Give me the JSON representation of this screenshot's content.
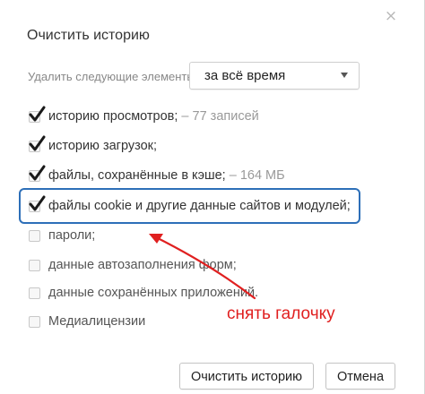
{
  "dialog": {
    "title": "Очистить историю",
    "close_glyph": "×"
  },
  "range": {
    "label": "Удалить следующие элементы:",
    "selected": "за всё время"
  },
  "options": [
    {
      "label": "историю просмотров;",
      "note": " –  77 записей",
      "checked": true
    },
    {
      "label": "историю загрузок;",
      "note": "",
      "checked": true
    },
    {
      "label": "файлы, сохранённые в кэше;",
      "note": " –  164 МБ",
      "checked": true
    },
    {
      "label": "файлы cookie и другие данные сайтов и модулей;",
      "note": "",
      "checked": true
    },
    {
      "label": "пароли;",
      "note": "",
      "checked": false
    },
    {
      "label": "данные автозаполнения форм;",
      "note": "",
      "checked": false
    },
    {
      "label": "данные сохранённых приложений.",
      "note": "",
      "checked": false
    },
    {
      "label": "Медиалицензии",
      "note": "",
      "checked": false
    }
  ],
  "annotation": {
    "text": "снять галочку",
    "color": "#e02020",
    "box_color": "#2d6fb8"
  },
  "buttons": {
    "clear_label": "Очистить историю",
    "cancel_label": "Отмена"
  },
  "icons": {
    "close": "close-icon",
    "chevron": "chevron-down-icon",
    "check": "checkmark-icon"
  }
}
